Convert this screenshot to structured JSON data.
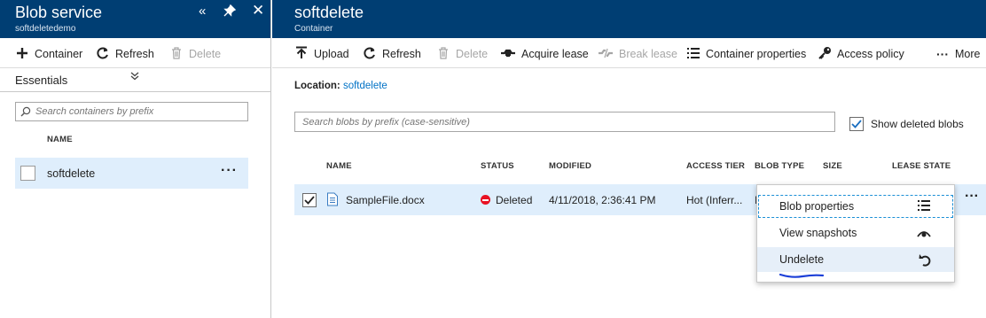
{
  "left": {
    "title": "Blob service",
    "subtitle": "softdeletedemo",
    "toolbar": {
      "container": "Container",
      "refresh": "Refresh",
      "delete": "Delete"
    },
    "essentials": "Essentials",
    "search_placeholder": "Search containers by prefix",
    "name_header": "NAME",
    "containers": [
      {
        "name": "softdelete"
      }
    ]
  },
  "right": {
    "title": "softdelete",
    "subtitle": "Container",
    "toolbar": {
      "upload": "Upload",
      "refresh": "Refresh",
      "delete": "Delete",
      "acquire_lease": "Acquire lease",
      "break_lease": "Break lease",
      "container_properties": "Container properties",
      "access_policy": "Access policy",
      "more": "More"
    },
    "location_label": "Location:",
    "location_value": "softdelete",
    "search_placeholder": "Search blobs by prefix (case-sensitive)",
    "show_deleted_label": "Show deleted blobs",
    "show_deleted_checked": true,
    "columns": [
      "NAME",
      "STATUS",
      "MODIFIED",
      "ACCESS TIER",
      "BLOB TYPE",
      "SIZE",
      "LEASE STATE"
    ],
    "blobs": [
      {
        "name": "SampleFile.docx",
        "status": "Deleted",
        "modified": "4/11/2018, 2:36:41 PM",
        "access_tier": "Hot (Inferr...",
        "blob_type_partial": "I",
        "selected": true
      }
    ],
    "context_menu": [
      {
        "label": "Blob properties",
        "icon": "list-icon"
      },
      {
        "label": "View snapshots",
        "icon": "eye-icon"
      },
      {
        "label": "Undelete",
        "icon": "undo-icon"
      }
    ]
  },
  "colors": {
    "header": "#003e73",
    "selected_row": "#dfeefc",
    "link": "#0072c6",
    "deleted": "#e81123",
    "annotation": "#1b3fd8"
  }
}
